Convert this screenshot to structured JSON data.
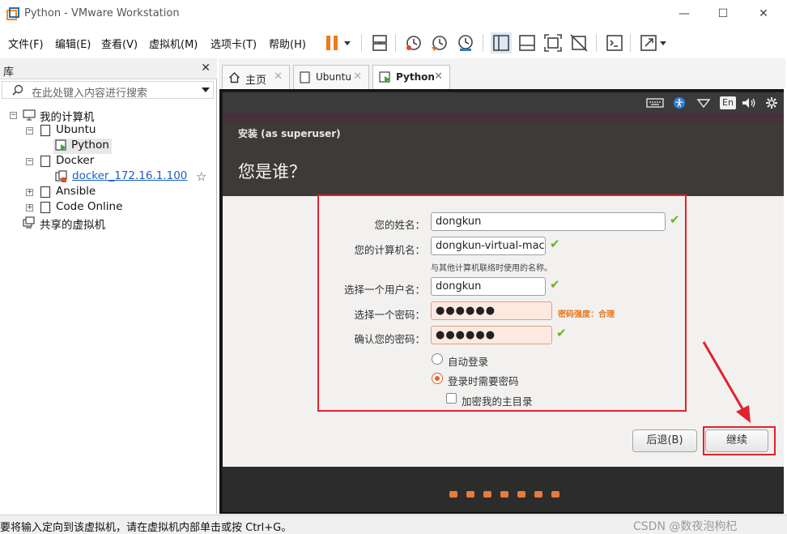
{
  "window": {
    "title": "Python - VMware Workstation"
  },
  "menu": [
    "文件(F)",
    "编辑(E)",
    "查看(V)",
    "虚拟机(M)",
    "选项卡(T)",
    "帮助(H)"
  ],
  "library": {
    "header": "库",
    "search_placeholder": "在此处键入内容进行搜索",
    "tree": {
      "my_computer": "我的计算机",
      "ubuntu": "Ubuntu",
      "python": "Python",
      "docker": "Docker",
      "docker_vm": "docker_172.16.1.100",
      "ansible": "Ansible",
      "code_online": "Code Online",
      "shared": "共享的虚拟机"
    }
  },
  "tabs": [
    {
      "label": "主页"
    },
    {
      "label": "Ubuntu"
    },
    {
      "label": "Python"
    }
  ],
  "vm": {
    "top_indicators": {
      "lang": "En"
    },
    "header_sub": "安装 (as superuser)",
    "header_title": "您是谁？",
    "form": {
      "name_label": "您的姓名：",
      "name_value": "dongkun",
      "computer_label": "您的计算机名：",
      "computer_value": "dongkun-virtual-mach",
      "computer_hint": "与其他计算机联络时使用的名称。",
      "user_label": "选择一个用户名：",
      "user_value": "dongkun",
      "pw_label": "选择一个密码：",
      "pw_value": "●●●●●●",
      "pw_strength": "密码强度：合理",
      "confirm_label": "确认您的密码：",
      "confirm_value": "●●●●●●",
      "opt_auto": "自动登录",
      "opt_require": "登录时需要密码",
      "opt_encrypt": "加密我的主目录"
    },
    "buttons": {
      "back": "后退(B)",
      "continue": "继续"
    }
  },
  "status": {
    "message": "要将输入定向到该虚拟机，请在虚拟机内部单击或按 Ctrl+G。",
    "watermark": "CSDN @数夜泡枸杞"
  },
  "colors": {
    "accent": "#e2622d",
    "highlight_box": "#e2222a",
    "check": "#6ab026"
  }
}
